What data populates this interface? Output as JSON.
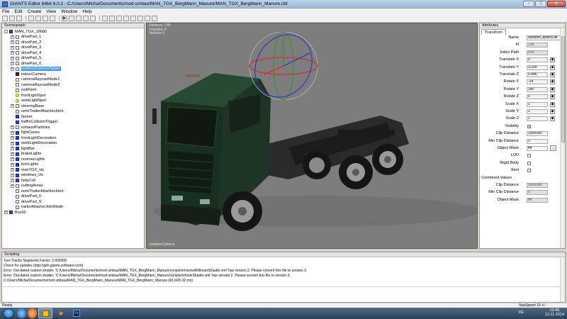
{
  "app": {
    "title": "GIANTS Editor 64bit 6.0.2 - C:/Users/Micha/Documents/mod umbau/MAN_TGX_BergMann_Manure/MAN_TGX_BergMann_Manure.i3d",
    "menu": [
      "File",
      "Edit",
      "Create",
      "View",
      "Window",
      "Help"
    ]
  },
  "scenegraph": {
    "title": "Scenegraph",
    "nodes": [
      {
        "label": "MAN_TGX_18680",
        "icon": "shape-icon",
        "depth": 0,
        "expander": "-"
      },
      {
        "label": "drivePart_1",
        "icon": "transform-icon",
        "depth": 1,
        "expander": "+"
      },
      {
        "label": "drivePart_2",
        "icon": "transform-icon",
        "depth": 1,
        "expander": "+"
      },
      {
        "label": "drivePart_3",
        "icon": "transform-icon",
        "depth": 1,
        "expander": "+"
      },
      {
        "label": "drivePart_4",
        "icon": "transform-icon",
        "depth": 1,
        "expander": "+"
      },
      {
        "label": "drivePart_5",
        "icon": "transform-icon",
        "depth": 1,
        "expander": "+"
      },
      {
        "label": "drivePart_6",
        "icon": "transform-icon",
        "depth": 1,
        "expander": "+"
      },
      {
        "label": "outdoorCameraTarget",
        "icon": "transform-icon",
        "depth": 1,
        "expander": "+",
        "selected": true
      },
      {
        "label": "indoorCamera",
        "icon": "camera-icon",
        "depth": 1,
        "expander": ""
      },
      {
        "label": "cameraRaycastNode1",
        "icon": "transform-icon",
        "depth": 1,
        "expander": ""
      },
      {
        "label": "cameraRaycastNode2",
        "icon": "transform-icon",
        "depth": 1,
        "expander": ""
      },
      {
        "label": "exitPoint",
        "icon": "transform-icon",
        "depth": 1,
        "expander": ""
      },
      {
        "label": "frontLightSpot",
        "icon": "light-icon",
        "depth": 1,
        "expander": ""
      },
      {
        "label": "workLightSpot",
        "icon": "light-icon",
        "depth": 1,
        "expander": ""
      },
      {
        "label": "steeringBase",
        "icon": "transform-icon",
        "depth": 1,
        "expander": "+"
      },
      {
        "label": "semiTrailerAttacherJoint",
        "icon": "transform-icon",
        "depth": 1,
        "expander": ""
      },
      {
        "label": "fanner",
        "icon": "shape-icon",
        "depth": 1,
        "expander": ""
      },
      {
        "label": "trafficCollisionTrigger",
        "icon": "shape-icon",
        "depth": 1,
        "expander": ""
      },
      {
        "label": "exhaustParticles",
        "icon": "transform-icon",
        "depth": 1,
        "expander": "+"
      },
      {
        "label": "lightCones",
        "icon": "shape-icon",
        "depth": 1,
        "expander": "+"
      },
      {
        "label": "frontLightDecoration",
        "icon": "shape-icon",
        "depth": 1,
        "expander": "+"
      },
      {
        "label": "workLightDecoration",
        "icon": "shape-icon",
        "depth": 1,
        "expander": "+"
      },
      {
        "label": "lightBar",
        "icon": "shape-icon",
        "depth": 1,
        "expander": "+"
      },
      {
        "label": "brakeLights",
        "icon": "shape-icon",
        "depth": 1,
        "expander": "+"
      },
      {
        "label": "reverseLights",
        "icon": "shape-icon",
        "depth": 1,
        "expander": "+"
      },
      {
        "label": "turnLights",
        "icon": "shape-icon",
        "depth": 1,
        "expander": "+"
      },
      {
        "label": "manTGX_vis",
        "icon": "shape-icon",
        "depth": 1,
        "expander": "+"
      },
      {
        "label": "windows_vis",
        "icon": "shape-icon",
        "depth": 1,
        "expander": "+"
      },
      {
        "label": "helpColl",
        "icon": "shape-icon",
        "depth": 1,
        "expander": "+"
      },
      {
        "label": "cuttingAreas",
        "icon": "transform-icon",
        "depth": 1,
        "expander": "+"
      },
      {
        "label": "semiTrailerAttacherJoint",
        "icon": "transform-icon",
        "depth": 1,
        "expander": ""
      },
      {
        "label": "drivePart_6",
        "icon": "transform-icon",
        "depth": 1,
        "expander": ""
      },
      {
        "label": "drivePart_5",
        "icon": "transform-icon",
        "depth": 1,
        "expander": ""
      },
      {
        "label": "trailerAttacherJointNode",
        "icon": "transform-icon",
        "depth": 1,
        "expander": ""
      },
      {
        "label": "Box02",
        "icon": "shape-icon",
        "depth": 0,
        "expander": "+"
      }
    ]
  },
  "viewport": {
    "info_lines": [
      "Distance 7.85",
      "Triangles 0",
      "Vertices 0"
    ],
    "camera_label": "outdoorCamera"
  },
  "attributes": {
    "title": "Attributes",
    "tab": "Transform",
    "rows": [
      {
        "label": "Name",
        "value": "outdoorCameraTar",
        "kind": "text-wide"
      },
      {
        "label": "Id",
        "value": "139",
        "kind": "readonly"
      },
      {
        "label": "Index Path",
        "value": "0>6",
        "kind": "readonly"
      },
      {
        "label": "Translate X",
        "value": "0",
        "kind": "key"
      },
      {
        "label": "Translate Y",
        "value": "3.324",
        "kind": "key"
      },
      {
        "label": "Translate Z",
        "value": "0.946",
        "kind": "key"
      },
      {
        "label": "Rotate X",
        "value": "-24",
        "kind": "key"
      },
      {
        "label": "Rotate Y",
        "value": "180",
        "kind": "key"
      },
      {
        "label": "Rotate Z",
        "value": "0",
        "kind": "key"
      },
      {
        "label": "Scale X",
        "value": "1",
        "kind": "key"
      },
      {
        "label": "Scale Y",
        "value": "1",
        "kind": "key"
      },
      {
        "label": "Scale Z",
        "value": "1",
        "kind": "key"
      },
      {
        "label": "Visibility",
        "value": "✓",
        "kind": "check"
      },
      {
        "label": "Clip Distance",
        "value": "1000000",
        "kind": "text"
      },
      {
        "label": "Min Clip Distance",
        "value": "0",
        "kind": "text"
      },
      {
        "label": "Object Mask",
        "value": "ffff",
        "kind": "button"
      },
      {
        "label": "LOD",
        "value": "",
        "kind": "check"
      },
      {
        "label": "Rigid Body",
        "value": "",
        "kind": "check"
      },
      {
        "label": "Joint",
        "value": "",
        "kind": "check"
      }
    ],
    "combined_title": "Combined Values",
    "combined_rows": [
      {
        "label": "Clip Distance",
        "value": "1000000"
      },
      {
        "label": "Min Clip Distance",
        "value": "0"
      },
      {
        "label": "Object Mask",
        "value": "ffff"
      }
    ]
  },
  "scripting": {
    "title": "Scripting",
    "lines": [
      "  Tyre Tracks Segments Factor: 2.000000",
      "Check for updates (http://gdn.giants-software.com)",
      "Error: Out-dated custom shader. 'C:/Users/Micha/Documents/mod umbau/MAN_TGX_BergMann_Manure/scripts/emissiveBillboardShader.xml' has version 2. Please convert this file to version 3.",
      "Error: Out-dated custom shader. 'C:/Users/Micha/Documents/mod umbau/MAN_TGX_BergMann_Manure/scripts/vehicleShader.xml' has version 2. Please convert this file to version 3.",
      "C:/Users/Micha/Documents/mod umbau/MAN_TGX_BergMann_Manure/MAN_TGX_BergMann_Manure.i3d (420.32 ms)"
    ]
  },
  "statusbar": {
    "left": "Ready",
    "right": "NavSpeed 10 +/-"
  },
  "taskbar": {
    "language": "DE",
    "time": "12:45",
    "date": "13.11.2014"
  }
}
